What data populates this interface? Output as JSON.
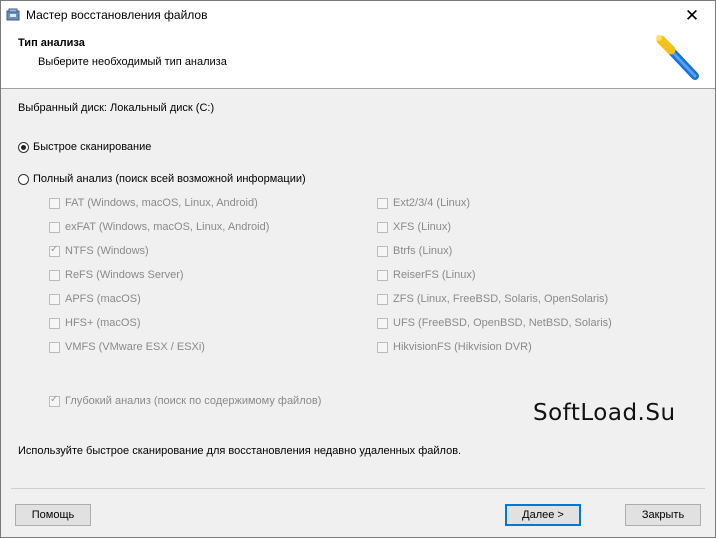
{
  "window": {
    "title": "Мастер восстановления файлов"
  },
  "header": {
    "title": "Тип анализа",
    "subtitle": "Выберите необходимый тип анализа"
  },
  "selected_disk": "Выбранный диск: Локальный диск (C:)",
  "scan_modes": {
    "quick": "Быстрое сканирование",
    "full": "Полный анализ (поиск всей возможной информации)",
    "selected": "quick"
  },
  "filesystems_left": [
    {
      "label": "FAT (Windows, macOS, Linux, Android)",
      "checked": false
    },
    {
      "label": "exFAT (Windows, macOS, Linux, Android)",
      "checked": false
    },
    {
      "label": "NTFS (Windows)",
      "checked": true
    },
    {
      "label": "ReFS (Windows Server)",
      "checked": false
    },
    {
      "label": "APFS (macOS)",
      "checked": false
    },
    {
      "label": "HFS+ (macOS)",
      "checked": false
    },
    {
      "label": "VMFS (VMware ESX / ESXi)",
      "checked": false
    }
  ],
  "filesystems_right": [
    {
      "label": "Ext2/3/4 (Linux)",
      "checked": false
    },
    {
      "label": "XFS (Linux)",
      "checked": false
    },
    {
      "label": "Btrfs (Linux)",
      "checked": false
    },
    {
      "label": "ReiserFS (Linux)",
      "checked": false
    },
    {
      "label": "ZFS (Linux, FreeBSD, Solaris, OpenSolaris)",
      "checked": false
    },
    {
      "label": "UFS (FreeBSD, OpenBSD, NetBSD, Solaris)",
      "checked": false
    },
    {
      "label": "HikvisionFS (Hikvision DVR)",
      "checked": false
    }
  ],
  "deep_analysis": {
    "label": "Глубокий анализ (поиск по содержимому файлов)",
    "checked": true
  },
  "watermark": "SoftLoad.Su",
  "hint": "Используйте быстрое сканирование для восстановления недавно удаленных файлов.",
  "buttons": {
    "help": "Помощь",
    "next": "Далее >",
    "close": "Закрыть"
  },
  "colors": {
    "accent": "#0078d7",
    "disabled_text": "#8a8a8a"
  }
}
